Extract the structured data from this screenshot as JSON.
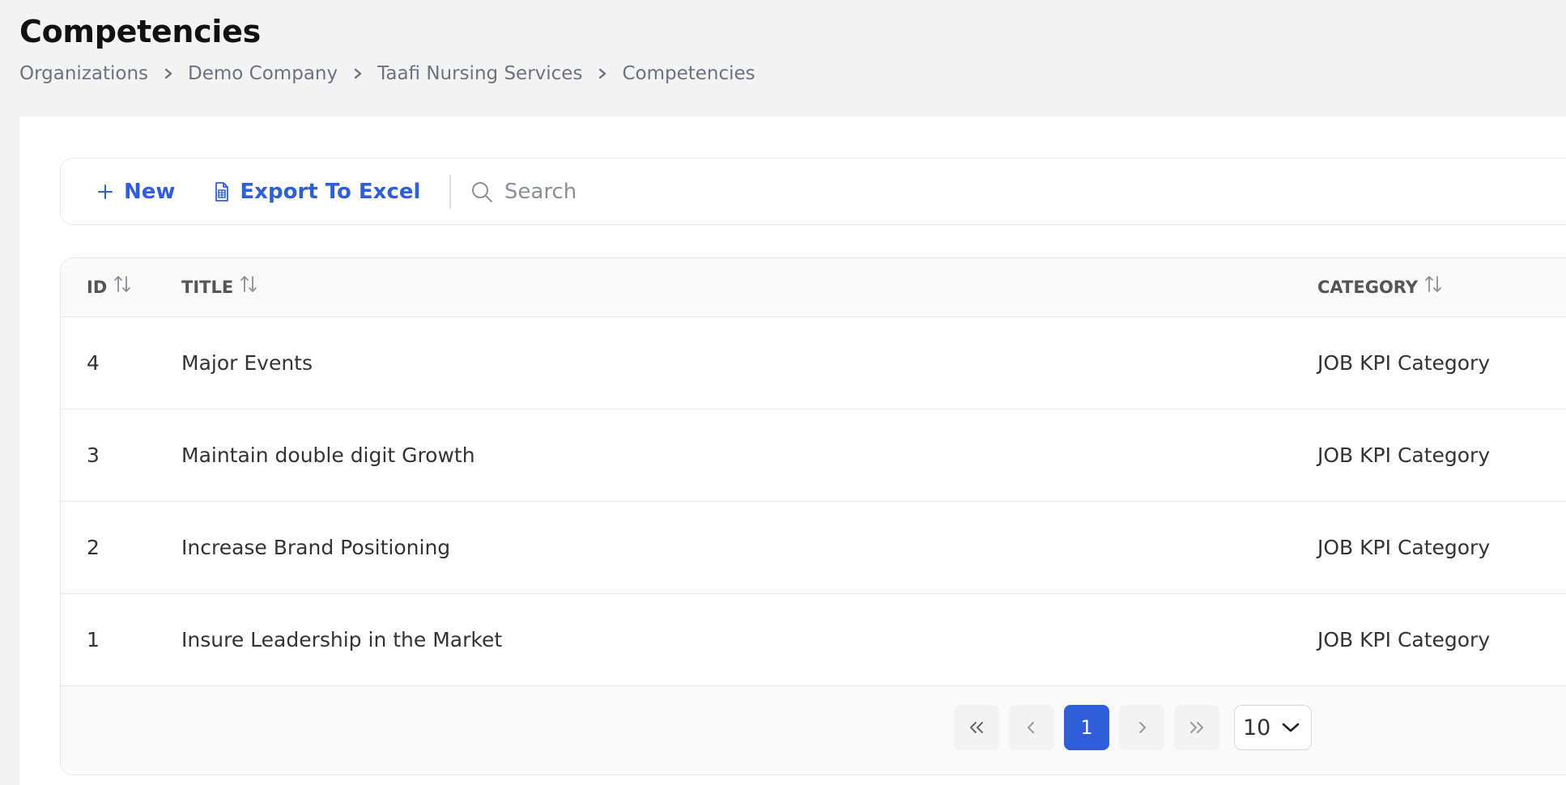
{
  "page": {
    "title": "Competencies"
  },
  "breadcrumb": [
    {
      "label": "Organizations"
    },
    {
      "label": "Demo Company"
    },
    {
      "label": "Taafi Nursing Services"
    },
    {
      "label": "Competencies"
    }
  ],
  "toolbar": {
    "new_label": "New",
    "export_label": "Export To Excel",
    "search_placeholder": "Search",
    "search_value": ""
  },
  "table": {
    "columns": [
      {
        "label": "ID"
      },
      {
        "label": "TITLE"
      },
      {
        "label": "CATEGORY"
      }
    ],
    "rows": [
      {
        "id": "4",
        "title": "Major Events",
        "category": "JOB KPI Category"
      },
      {
        "id": "3",
        "title": "Maintain double digit Growth",
        "category": "JOB KPI Category"
      },
      {
        "id": "2",
        "title": "Increase Brand Positioning",
        "category": "JOB KPI Category"
      },
      {
        "id": "1",
        "title": "Insure Leadership in the Market",
        "category": "JOB KPI Category"
      }
    ]
  },
  "pagination": {
    "current_page": "1",
    "page_size": "10"
  },
  "colors": {
    "accent": "#2f5ed8",
    "background": "#f3f3f3",
    "panel": "#ffffff",
    "border": "#e5e7eb"
  },
  "icons": {
    "new": "plus-icon",
    "export": "spreadsheet-file-icon",
    "search": "search-icon",
    "sort": "sort-arrows-icon",
    "breadcrumb_separator": "chevron-right-icon",
    "first_page": "double-chevron-left-icon",
    "prev_page": "chevron-left-icon",
    "next_page": "chevron-right-icon",
    "last_page": "double-chevron-right-icon",
    "page_size_dropdown": "chevron-down-icon"
  }
}
